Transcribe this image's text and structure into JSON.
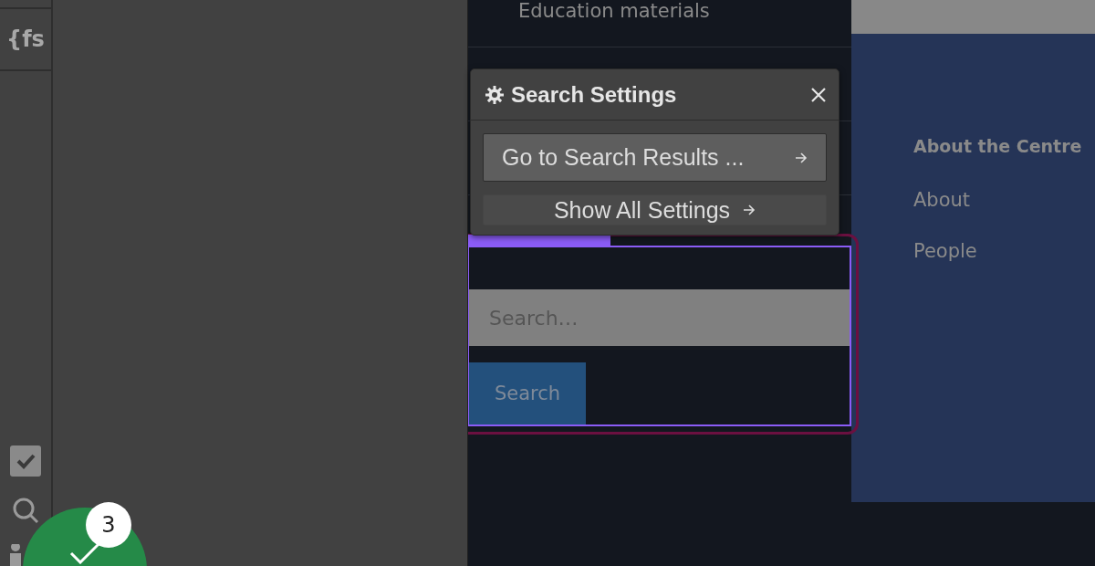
{
  "toolbar": {
    "logo": "{fs",
    "tools": [
      {
        "kind": "checkbox",
        "selected": true
      },
      {
        "kind": "search",
        "selected": false
      },
      {
        "kind": "people",
        "selected": false
      }
    ]
  },
  "notification": {
    "count": "3"
  },
  "canvas": {
    "nav_items": [
      "Education materials"
    ],
    "search_field": {
      "placeholder": "Search…"
    },
    "search_button": "Search"
  },
  "right_panel": {
    "heading": "About the Centre",
    "links": [
      "About",
      "People"
    ]
  },
  "popover": {
    "title": "Search Settings",
    "actions": [
      {
        "label": "Go to Search Results ...",
        "kind": "primary"
      },
      {
        "label": "Show All Settings",
        "kind": "secondary"
      }
    ]
  }
}
